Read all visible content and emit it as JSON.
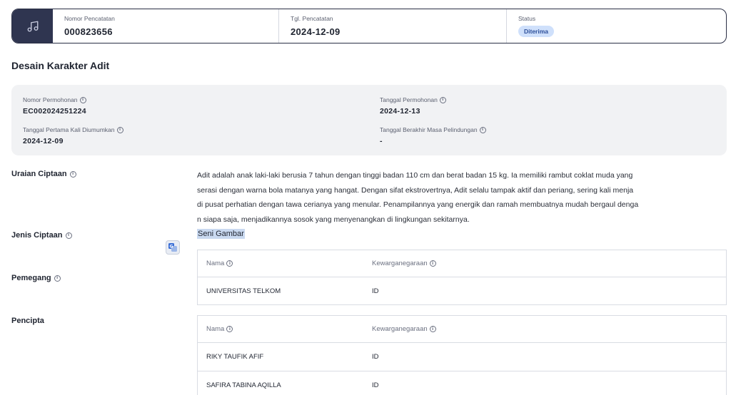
{
  "header": {
    "icon": "music-note-icon",
    "nomor_pencatatan": {
      "label": "Nomor Pencatatan",
      "value": "000823656"
    },
    "tgl_pencatatan": {
      "label": "Tgl. Pencatatan",
      "value": "2024-12-09"
    },
    "status": {
      "label": "Status",
      "value": "Diterima"
    }
  },
  "title": "Desain Karakter Adit",
  "info": {
    "nomor_permohonan": {
      "label": "Nomor Permohonan",
      "value": "EC002024251224"
    },
    "tanggal_permohonan": {
      "label": "Tanggal Permohonan",
      "value": "2024-12-13"
    },
    "tanggal_pertama": {
      "label": "Tanggal Pertama Kali Diumumkan",
      "value": "2024-12-09"
    },
    "tanggal_berakhir": {
      "label": "Tanggal Berakhir Masa Pelindungan",
      "value": "-"
    }
  },
  "uraian": {
    "label": "Uraian Ciptaan",
    "lines": [
      "Adit adalah anak laki-laki berusia 7 tahun dengan tinggi badan 110 cm dan berat badan 15 kg. Ia memiliki rambut coklat muda yang",
      "serasi dengan warna bola matanya yang hangat. Dengan sifat ekstrovertnya, Adit selalu tampak aktif dan periang, sering kali menja",
      "di pusat perhatian dengan tawa cerianya yang menular. Penampilannya yang energik dan ramah membuatnya mudah bergaul denga",
      "n siapa saja, menjadikannya sosok yang menyenangkan di lingkungan sekitarnya."
    ]
  },
  "jenis": {
    "label": "Jenis Ciptaan",
    "value": "Seni Gambar"
  },
  "pemegang": {
    "label": "Pemegang",
    "headers": {
      "nama": "Nama",
      "kewarganegaraan": "Kewarganegaraan"
    },
    "rows": [
      {
        "nama": "UNIVERSITAS TELKOM",
        "kewarganegaraan": "ID"
      }
    ]
  },
  "pencipta": {
    "label": "Pencipta",
    "headers": {
      "nama": "Nama",
      "kewarganegaraan": "Kewarganegaraan"
    },
    "rows": [
      {
        "nama": "RIKY TAUFIK AFIF",
        "kewarganegaraan": "ID"
      },
      {
        "nama": "SAFIRA TABINA AQILLA",
        "kewarganegaraan": "ID"
      }
    ]
  },
  "colors": {
    "accent": "#2f3550",
    "badge_bg": "#cfe0fb",
    "badge_text": "#2d4f9a",
    "panel": "#f1f2f4"
  }
}
